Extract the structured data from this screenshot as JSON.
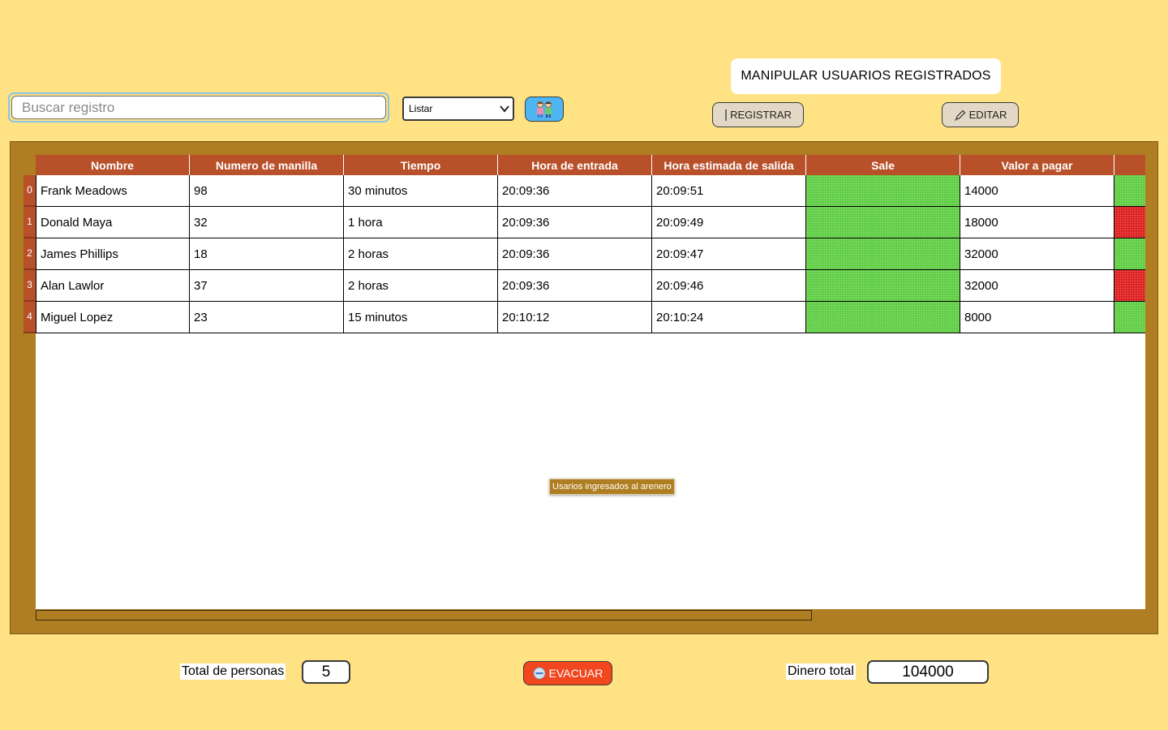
{
  "toolbar": {
    "search_placeholder": "Buscar registro",
    "select_value": "Listar",
    "kids_icon": "children-icon"
  },
  "manage": {
    "title": "MANIPULAR USUARIOS REGISTRADOS",
    "register_label": "REGISTRAR",
    "edit_label": "EDITAR"
  },
  "table": {
    "columns": [
      "Nombre",
      "Numero de manilla",
      "Tiempo",
      "Hora de entrada",
      "Hora estimada de salida",
      "Sale",
      "Valor a pagar",
      ""
    ],
    "rows": [
      {
        "index": "0",
        "nombre": "Frank Meadows",
        "manilla": "98",
        "tiempo": "30 minutos",
        "entrada": "20:09:36",
        "salida": "20:09:51",
        "valor": "14000",
        "status": "green"
      },
      {
        "index": "1",
        "nombre": "Donald Maya",
        "manilla": "32",
        "tiempo": "1 hora",
        "entrada": "20:09:36",
        "salida": "20:09:49",
        "valor": "18000",
        "status": "red"
      },
      {
        "index": "2",
        "nombre": "James Phillips",
        "manilla": "18",
        "tiempo": "2 horas",
        "entrada": "20:09:36",
        "salida": "20:09:47",
        "valor": "32000",
        "status": "green"
      },
      {
        "index": "3",
        "nombre": "Alan Lawlor",
        "manilla": "37",
        "tiempo": "2 horas",
        "entrada": "20:09:36",
        "salida": "20:09:46",
        "valor": "32000",
        "status": "red"
      },
      {
        "index": "4",
        "nombre": "Miguel Lopez",
        "manilla": "23",
        "tiempo": "15 minutos",
        "entrada": "20:10:12",
        "salida": "20:10:24",
        "valor": "8000",
        "status": "green"
      }
    ],
    "tooltip": "Usarios ingresados al arenero"
  },
  "footer": {
    "total_personas_label": "Total de personas",
    "total_personas_value": "5",
    "evacuar_label": "EVACUAR",
    "dinero_label": "Dinero total",
    "dinero_value": "104000"
  },
  "colors": {
    "background": "#fee283",
    "panel": "#b07e22",
    "header": "#b8502a",
    "status_green": "#5ecb43",
    "status_red": "#d81e1e",
    "evacuar": "#f2461f",
    "kids_button": "#4fb5f1"
  }
}
